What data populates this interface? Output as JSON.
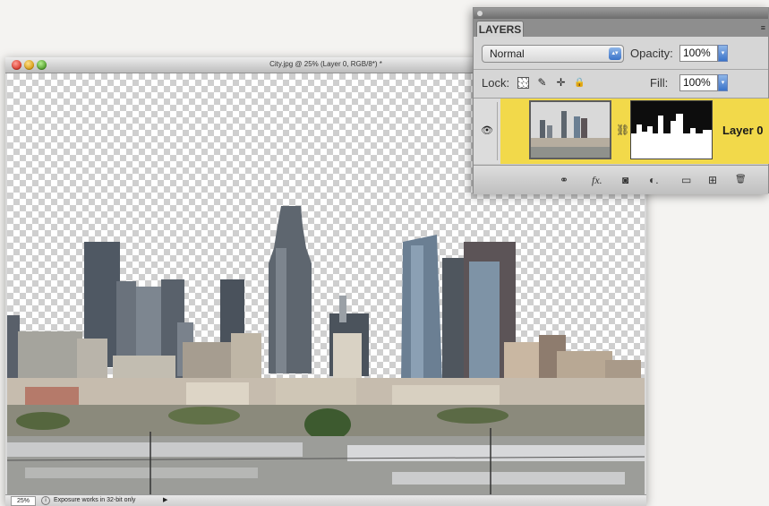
{
  "document": {
    "title": "City.jpg @ 25% (Layer 0, RGB/8*) *",
    "zoom": "25%",
    "status_text": "Exposure works in 32-bit only",
    "status_icon": "info-icon",
    "status_arrow": "▶"
  },
  "layers_panel": {
    "tab_label": "LAYERS",
    "menu_icon": "≡",
    "blend_mode": "Normal",
    "blend_stepper": "▴▾",
    "opacity_label": "Opacity:",
    "opacity_value": "100%",
    "fill_label": "Fill:",
    "fill_value": "100%",
    "field_arrow": "▾",
    "lock_label": "Lock:",
    "lock_icons": {
      "transparent": "",
      "paint": "✎",
      "move": "✛",
      "all": "🔒"
    },
    "eye_glyph": "👁",
    "link_glyph": "⛓",
    "layers": [
      {
        "name": "Layer 0",
        "selected": true,
        "visible": true
      }
    ],
    "footer_icons": {
      "link": "⚭",
      "fx": "fx.",
      "mask": "◙",
      "adjustment": "◐.",
      "group": "▭",
      "new": "⊞",
      "delete": "🗑"
    },
    "highlight_color": "#f2d94a"
  }
}
